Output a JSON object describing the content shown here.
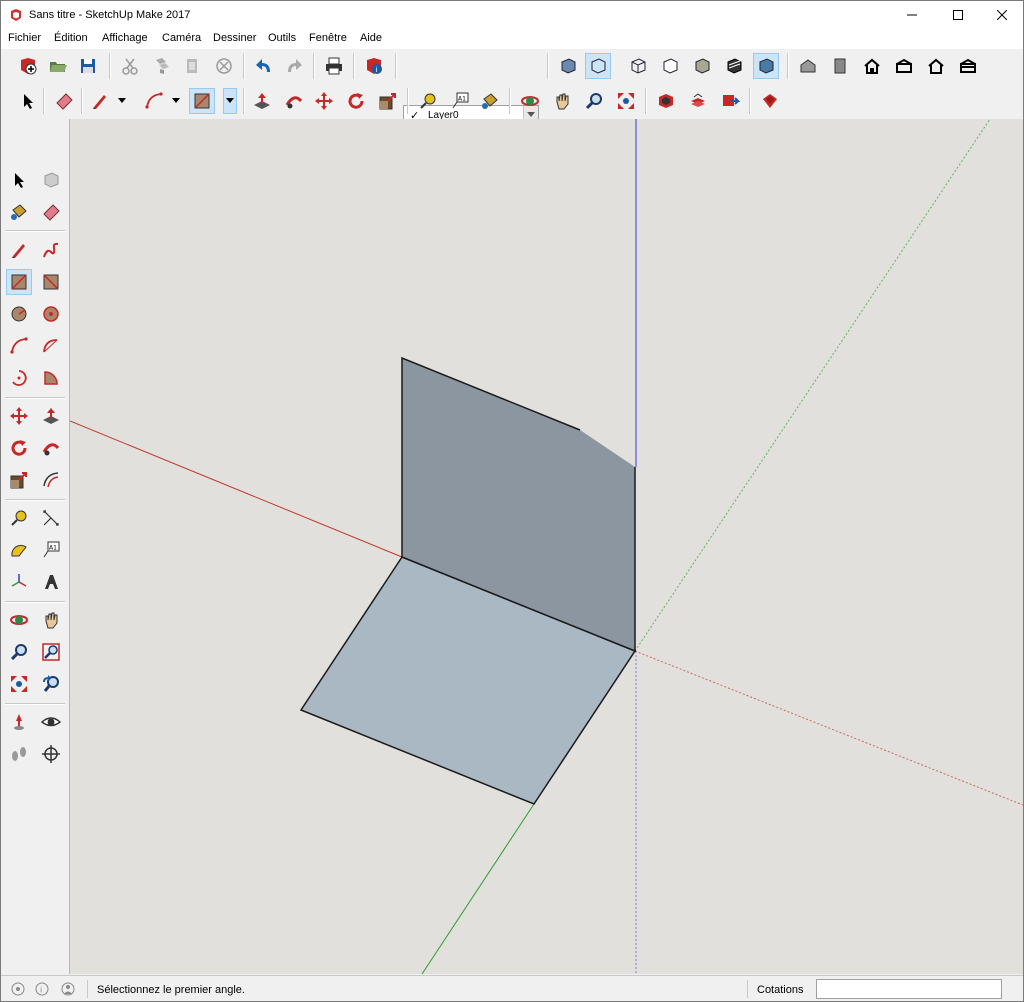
{
  "window": {
    "title": "Sans titre - SketchUp Make 2017"
  },
  "menu": [
    "Fichier",
    "Édition",
    "Affichage",
    "Caméra",
    "Dessiner",
    "Outils",
    "Fenêtre",
    "Aide"
  ],
  "layer": {
    "check": "✓",
    "name": "Layer0"
  },
  "status": {
    "message": "Sélectionnez le premier angle.",
    "measurements_label": "Cotations",
    "measurements_value": ""
  },
  "colors": {
    "viewport_bg": "#e1e0dc",
    "face_vertical": "#8b96a0",
    "face_ground": "#a9b8c3",
    "axis_red": "#c0392b",
    "axis_green": "#2e9e2e",
    "axis_blue": "#3a3ad0"
  }
}
